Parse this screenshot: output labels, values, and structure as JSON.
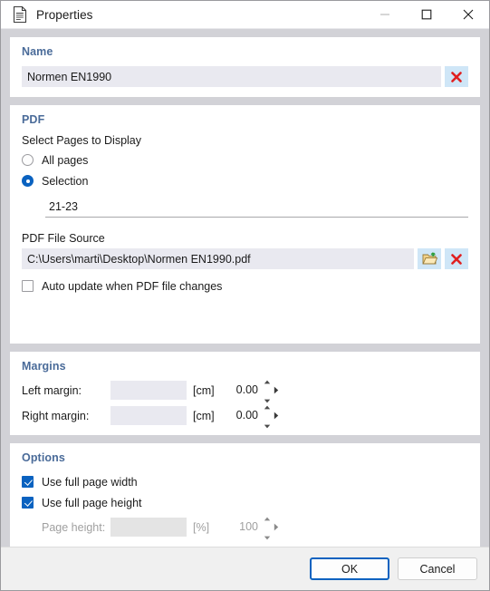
{
  "window": {
    "title": "Properties",
    "icon": "document-icon",
    "minimize_label": "Minimize",
    "maximize_label": "Maximize",
    "close_label": "Close",
    "minimize_enabled": false
  },
  "name_section": {
    "title": "Name",
    "value": "Normen EN1990",
    "clear_label": "Clear name"
  },
  "pdf_section": {
    "title": "PDF",
    "select_pages_label": "Select Pages to Display",
    "all_pages_label": "All pages",
    "selection_label": "Selection",
    "selection_value": "21-23",
    "all_pages_checked": false,
    "selection_checked": true,
    "file_source_label": "PDF File Source",
    "file_source_value": "C:\\Users\\marti\\Desktop\\Normen EN1990.pdf",
    "browse_label": "Browse for PDF file",
    "clear_label": "Clear PDF file source",
    "auto_update_label": "Auto update when PDF file changes",
    "auto_update_checked": false
  },
  "margins_section": {
    "title": "Margins",
    "left_label": "Left margin:",
    "left_value": "0.00",
    "left_unit": "[cm]",
    "right_label": "Right margin:",
    "right_value": "0.00",
    "right_unit": "[cm]"
  },
  "options_section": {
    "title": "Options",
    "full_width_label": "Use full page width",
    "full_width_checked": true,
    "full_height_label": "Use full page height",
    "full_height_checked": true,
    "page_height_label": "Page height:",
    "page_height_value": "100",
    "page_height_unit": "[%]",
    "page_height_enabled": false
  },
  "footer": {
    "ok_label": "OK",
    "cancel_label": "Cancel"
  },
  "colors": {
    "accent": "#0a62c0",
    "group_title": "#4a6b99",
    "dialog_bg": "#d2d2d7",
    "field_bg": "#e9e9f0",
    "icon_btn_bg": "#cfe6f7",
    "delete_red": "#e02020"
  }
}
